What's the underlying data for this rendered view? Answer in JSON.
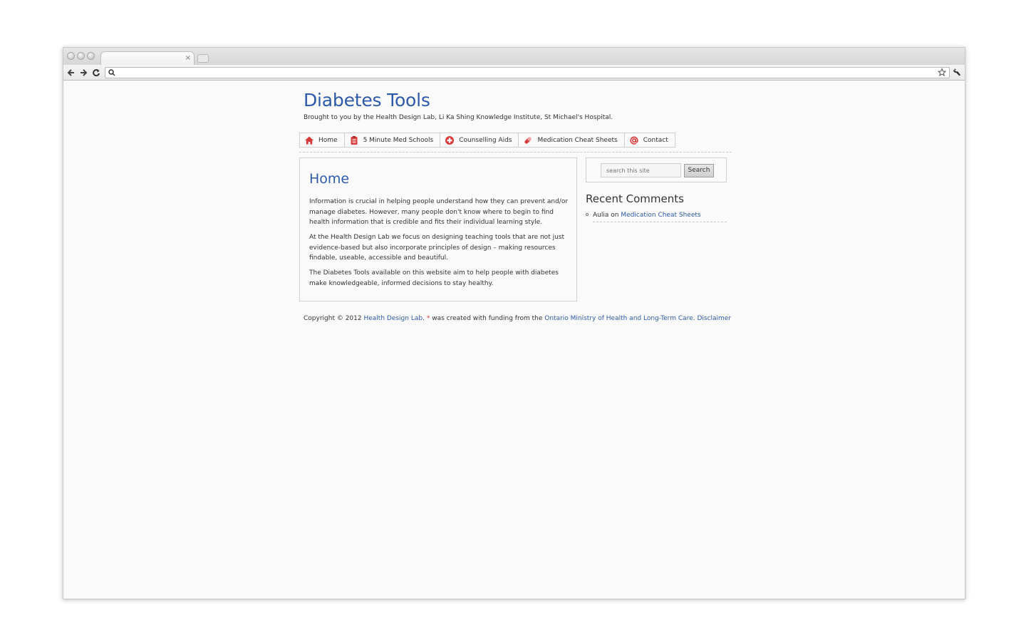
{
  "browser": {
    "tab_title": "",
    "tab_close": "×",
    "url": "",
    "search_glyph": "⚲",
    "icons": {
      "back": "arrow-left-icon",
      "forward": "arrow-right-icon",
      "reload": "reload-icon",
      "star": "star-icon",
      "wrench": "wrench-icon"
    }
  },
  "site": {
    "title": "Diabetes Tools",
    "description": "Brought to you by the Health Design Lab, Li Ka Shing Knowledge Institute, St Michael's Hospital."
  },
  "nav": {
    "items": [
      {
        "label": "Home",
        "icon": "home-icon"
      },
      {
        "label": "5 Minute Med Schools",
        "icon": "clipboard-icon"
      },
      {
        "label": "Counselling Aids",
        "icon": "medical-cross-icon"
      },
      {
        "label": "Medication Cheat Sheets",
        "icon": "pill-icon"
      },
      {
        "label": "Contact",
        "icon": "at-sign-icon"
      }
    ]
  },
  "main": {
    "heading": "Home",
    "paragraphs": [
      "Information is crucial in helping people understand how they can prevent and/or manage diabetes. However, many people don't know where to begin to find health information that is credible and fits their individual learning style.",
      "At the Health Design Lab we focus on designing teaching tools that are not just evidence-based but also incorporate principles of design – making resources findable, useable, accessible and beautiful.",
      "The Diabetes Tools available on this website aim to help people with diabetes make knowledgeable, informed decisions to stay healthy."
    ]
  },
  "sidebar": {
    "search_placeholder": "search this site",
    "search_button": "Search",
    "recent_comments_title": "Recent Comments",
    "comment": {
      "author": "Aulia",
      "on": "on",
      "post": "Medication Cheat Sheets"
    }
  },
  "footer": {
    "copyright": "Copyright © 2012",
    "lab_link": "Health Design Lab",
    "sep": ".",
    "asterisk": "*",
    "funding_text": "was created with funding from the",
    "ministry_link": "Ontario Ministry of Health and Long-Term Care",
    "disclaimer_link": "Disclaimer"
  },
  "colors": {
    "link_blue": "#2d5aa8",
    "accent_red": "#d33333"
  }
}
